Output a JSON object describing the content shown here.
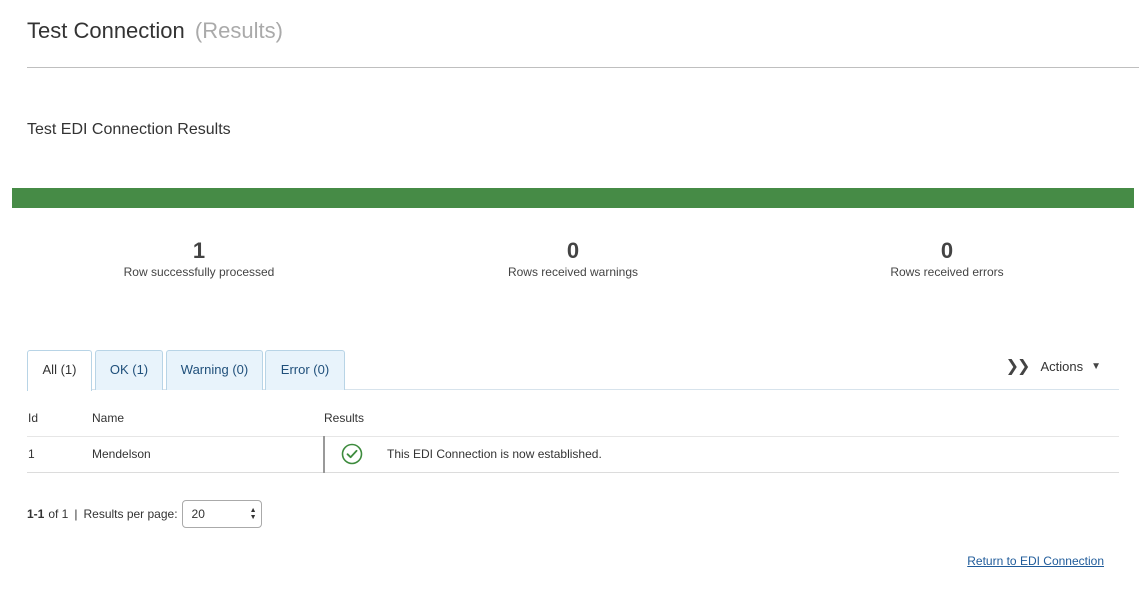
{
  "header": {
    "title": "Test Connection",
    "subtitle": "(Results)"
  },
  "section": {
    "title": "Test EDI Connection Results"
  },
  "progress": {
    "fraction": 1.0,
    "color": "#468b46"
  },
  "stats": [
    {
      "value": "1",
      "label": "Row successfully processed"
    },
    {
      "value": "0",
      "label": "Rows received warnings"
    },
    {
      "value": "0",
      "label": "Rows received errors"
    }
  ],
  "tabs": [
    {
      "label": "All (1)",
      "active": true
    },
    {
      "label": "OK (1)",
      "active": false
    },
    {
      "label": "Warning (0)",
      "active": false
    },
    {
      "label": "Error (0)",
      "active": false
    }
  ],
  "actions": {
    "label": "Actions",
    "icon": "double-chevron-right-icon",
    "caret_icon": "caret-down-icon"
  },
  "table": {
    "headers": [
      "Id",
      "Name",
      "Results"
    ],
    "rows": [
      {
        "id": "1",
        "name": "Mendelson",
        "status_icon": "check-circle-icon",
        "result": "This EDI Connection is now established."
      }
    ],
    "success_color": "#3d8b3d"
  },
  "pagination": {
    "range": "1-1",
    "of_label": "of 1",
    "separator": "|",
    "per_page_label": "Results per page:",
    "per_page_value": "20"
  },
  "links": {
    "return_label": "Return to EDI Connection"
  }
}
